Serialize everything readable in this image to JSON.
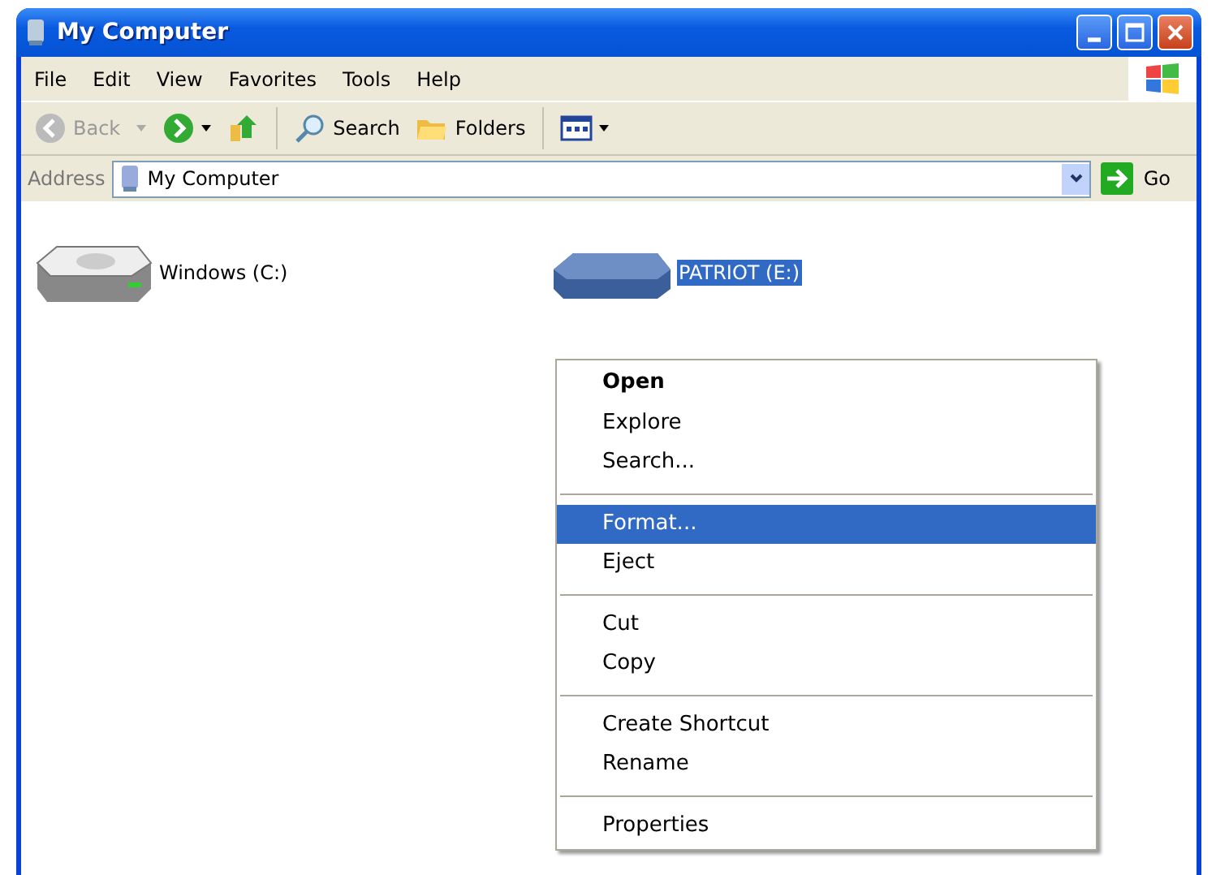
{
  "window": {
    "title": "My Computer"
  },
  "menu_bar": [
    "File",
    "Edit",
    "View",
    "Favorites",
    "Tools",
    "Help"
  ],
  "toolbar": [
    {
      "kind": "back",
      "label": "Back",
      "disabled": true
    },
    {
      "kind": "forward",
      "disabled": false
    },
    {
      "kind": "up",
      "disabled": false
    },
    {
      "kind": "search",
      "label": "Search",
      "disabled": false
    },
    {
      "kind": "folders",
      "label": "Folders",
      "disabled": false
    },
    {
      "kind": "views",
      "disabled": false
    }
  ],
  "address": {
    "label": "Address",
    "value": "My Computer",
    "go": "Go"
  },
  "drives": [
    {
      "kind": "hdd",
      "label": "Windows (C:)",
      "selected": false
    },
    {
      "kind": "usb",
      "label": "PATRIOT (E:)",
      "selected": true
    }
  ],
  "context_menu": [
    {
      "kind": "item",
      "label": "Open",
      "default": true,
      "selected": false
    },
    {
      "kind": "item",
      "label": "Explore",
      "default": false,
      "selected": false
    },
    {
      "kind": "item",
      "label": "Search...",
      "default": false,
      "selected": false
    },
    {
      "kind": "separator"
    },
    {
      "kind": "item",
      "label": "Format...",
      "default": false,
      "selected": true
    },
    {
      "kind": "item",
      "label": "Eject",
      "default": false,
      "selected": false
    },
    {
      "kind": "separator"
    },
    {
      "kind": "item",
      "label": "Cut",
      "default": false,
      "selected": false
    },
    {
      "kind": "item",
      "label": "Copy",
      "default": false,
      "selected": false
    },
    {
      "kind": "separator"
    },
    {
      "kind": "item",
      "label": "Create Shortcut",
      "default": false,
      "selected": false
    },
    {
      "kind": "item",
      "label": "Rename",
      "default": false,
      "selected": false
    },
    {
      "kind": "separator"
    },
    {
      "kind": "item",
      "label": "Properties",
      "default": false,
      "selected": false
    }
  ]
}
